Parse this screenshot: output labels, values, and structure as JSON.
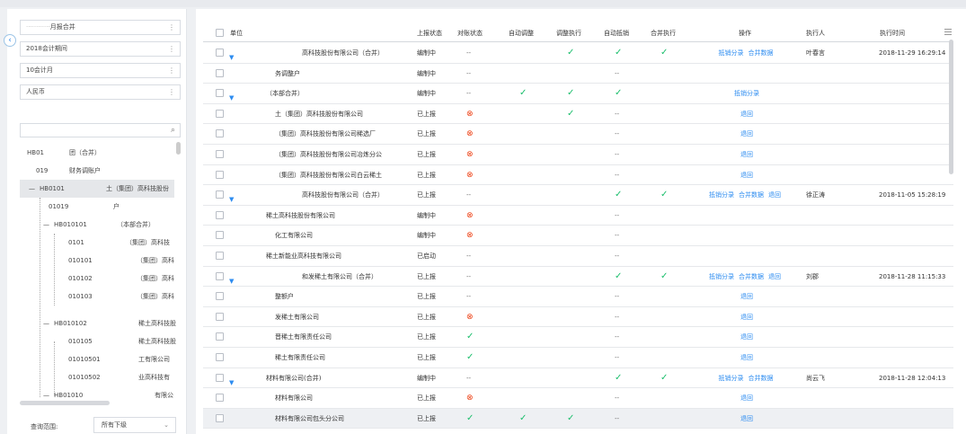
{
  "filters": [
    {
      "value": "月报合并",
      "prefix": "············"
    },
    {
      "value": "2018会计期间"
    },
    {
      "value": "10会计月"
    },
    {
      "value": "人民币"
    }
  ],
  "tree": [
    {
      "code": "HB01",
      "name": "团（合并）"
    },
    {
      "code": "019",
      "name": "财务调账户"
    },
    {
      "code": "HB0101",
      "name": "土（集团）高科技股份"
    },
    {
      "code": "01019",
      "name": "户"
    },
    {
      "code": "HB010101",
      "name": "（本部合并）"
    },
    {
      "code": "0101",
      "name": "（集团）高科技"
    },
    {
      "code": "010101",
      "name": "（集团）高科"
    },
    {
      "code": "010102",
      "name": "（集团）高科"
    },
    {
      "code": "010103",
      "name": "（集团）高科"
    },
    {
      "code": "HB010102",
      "name": "稀土高科技股"
    },
    {
      "code": "010105",
      "name": "稀土高科技股"
    },
    {
      "code": "01010501",
      "name": "工有限公司"
    },
    {
      "code": "01010502",
      "name": "业高科技有"
    },
    {
      "code": "HB01010",
      "name": "有限公"
    }
  ],
  "query_range": {
    "label": "查询范围:",
    "value": "所有下级"
  },
  "table": {
    "headers": {
      "unit": "单位",
      "report_status": "上报状态",
      "reconcile_status": "对账状态",
      "auto_adjust": "自动调整",
      "adjust_exec": "调整执行",
      "auto_offset": "自动抵销",
      "merge_exec": "合并执行",
      "ops": "操作",
      "executor": "执行人",
      "exec_time": "执行时间"
    },
    "rows": [
      {
        "unit": "高科技股份有限公司（合并）",
        "tri": true,
        "indent": 0,
        "status": "编制中",
        "rec": "--",
        "auto_adjust": "",
        "adjust_exec": "ok",
        "auto_offset": "ok",
        "merge_exec": "ok",
        "ops": [
          "抵销分录",
          "合并数据"
        ],
        "executor": "叶春言",
        "time": "2018-11-29 16:29:14"
      },
      {
        "unit": "务调整户",
        "indent": 2,
        "status": "编制中",
        "rec": "--",
        "auto_offset": "--",
        "ops": []
      },
      {
        "unit": "（本部合并）",
        "tri": true,
        "indent": 1,
        "status": "编制中",
        "rec": "--",
        "auto_adjust": "ok",
        "adjust_exec": "ok",
        "auto_offset": "ok",
        "ops": [
          "抵销分录"
        ]
      },
      {
        "unit": "土（集团）高科技股份有限公司",
        "indent": 2,
        "status": "已上报",
        "rec": "err",
        "adjust_exec": "ok",
        "auto_offset": "--",
        "ops": [
          "退回"
        ]
      },
      {
        "unit": "（集团）高科技股份有限公司稀选厂",
        "indent": 2,
        "status": "已上报",
        "rec": "err",
        "auto_offset": "--",
        "ops": [
          "退回"
        ]
      },
      {
        "unit": "（集团）高科技股份有限公司冶炼分公",
        "indent": 2,
        "status": "已上报",
        "rec": "err",
        "auto_offset": "--",
        "ops": [
          "退回"
        ]
      },
      {
        "unit": "（集团）高科技股份有限公司白云稀土",
        "indent": 2,
        "status": "已上报",
        "rec": "err",
        "auto_offset": "--",
        "ops": [
          "退回"
        ]
      },
      {
        "unit": "高科技股份有限公司（合并）",
        "tri": true,
        "indent": 0,
        "status": "已上报",
        "rec": "--",
        "auto_offset": "ok",
        "merge_exec": "ok",
        "ops": [
          "抵销分录",
          "合并数据",
          "退回"
        ],
        "executor": "徐正涛",
        "time": "2018-11-05 15:28:19"
      },
      {
        "unit": "稀土高科技股份有限公司",
        "indent": 1,
        "status": "编制中",
        "rec": "err",
        "auto_offset": "--",
        "ops": []
      },
      {
        "unit": "化工有限公司",
        "indent": 2,
        "status": "编制中",
        "rec": "err",
        "auto_offset": "--",
        "ops": []
      },
      {
        "unit": "稀土新能业高科技有限公司",
        "indent": 1,
        "status": "已启动",
        "rec": "--",
        "auto_offset": "--",
        "ops": []
      },
      {
        "unit": "和发稀土有限公司（合并）",
        "tri": true,
        "indent": 0,
        "status": "已上报",
        "rec": "--",
        "auto_offset": "ok",
        "merge_exec": "ok",
        "ops": [
          "抵销分录",
          "合并数据",
          "退回"
        ],
        "executor": "刘郡",
        "time": "2018-11-28 11:15:33"
      },
      {
        "unit": "整额户",
        "indent": 2,
        "status": "已上报",
        "rec": "--",
        "auto_offset": "--",
        "ops": [
          "退回"
        ]
      },
      {
        "unit": "发稀土有限公司",
        "indent": 2,
        "status": "已上报",
        "rec": "err",
        "auto_offset": "--",
        "ops": [
          "退回"
        ]
      },
      {
        "unit": "晋稀土有限责任公司",
        "indent": 2,
        "status": "已上报",
        "rec": "ok",
        "auto_offset": "--",
        "ops": [
          "退回"
        ]
      },
      {
        "unit": "稀土有限责任公司",
        "indent": 2,
        "status": "已上报",
        "rec": "ok",
        "auto_offset": "--",
        "ops": [
          "退回"
        ]
      },
      {
        "unit": "材料有限公司(合并)",
        "tri": true,
        "indent": 1,
        "status": "编制中",
        "rec": "--",
        "auto_offset": "ok",
        "merge_exec": "ok",
        "ops": [
          "抵销分录",
          "合并数据"
        ],
        "executor": "尚云飞",
        "time": "2018-11-28 12:04:13"
      },
      {
        "unit": "材料有限公司",
        "indent": 2,
        "status": "已上报",
        "rec": "err",
        "auto_offset": "--",
        "ops": [
          "退回"
        ]
      },
      {
        "unit": "材料有限公司包头分公司",
        "indent": 2,
        "status": "已上报",
        "rec": "ok",
        "auto_adjust": "ok",
        "adjust_exec": "ok",
        "auto_offset": "--",
        "ops": [
          "退回"
        ],
        "hl": true
      }
    ]
  },
  "icons": {
    "collapse": "chevron-left-icon",
    "search": "search-icon",
    "check": "check-icon",
    "error": "error-circle-icon",
    "expand": "triangle-down-icon",
    "menu": "menu-icon"
  }
}
